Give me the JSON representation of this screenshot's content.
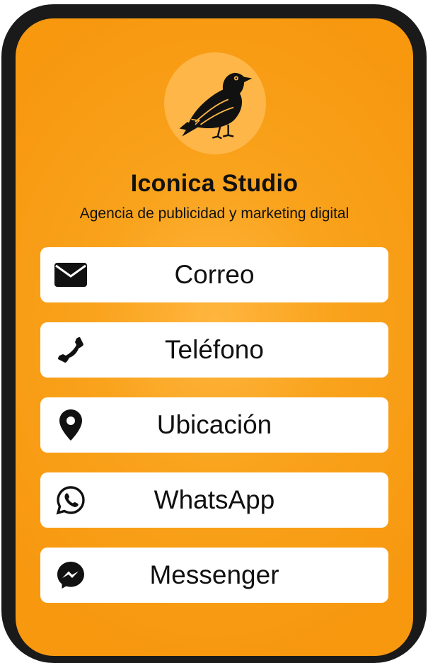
{
  "profile": {
    "name": "Iconica Studio",
    "tagline": "Agencia de publicidad y marketing digital",
    "avatar_icon": "crow-icon"
  },
  "colors": {
    "background": "#f9a21b",
    "avatar_circle": "#ffb648",
    "button": "#ffffff",
    "text": "#111111",
    "frame": "#1a1a1a"
  },
  "actions": [
    {
      "label": "Correo",
      "icon": "envelope-icon"
    },
    {
      "label": "Teléfono",
      "icon": "phone-icon"
    },
    {
      "label": "Ubicación",
      "icon": "map-pin-icon"
    },
    {
      "label": "WhatsApp",
      "icon": "whatsapp-icon"
    },
    {
      "label": "Messenger",
      "icon": "messenger-icon"
    }
  ]
}
